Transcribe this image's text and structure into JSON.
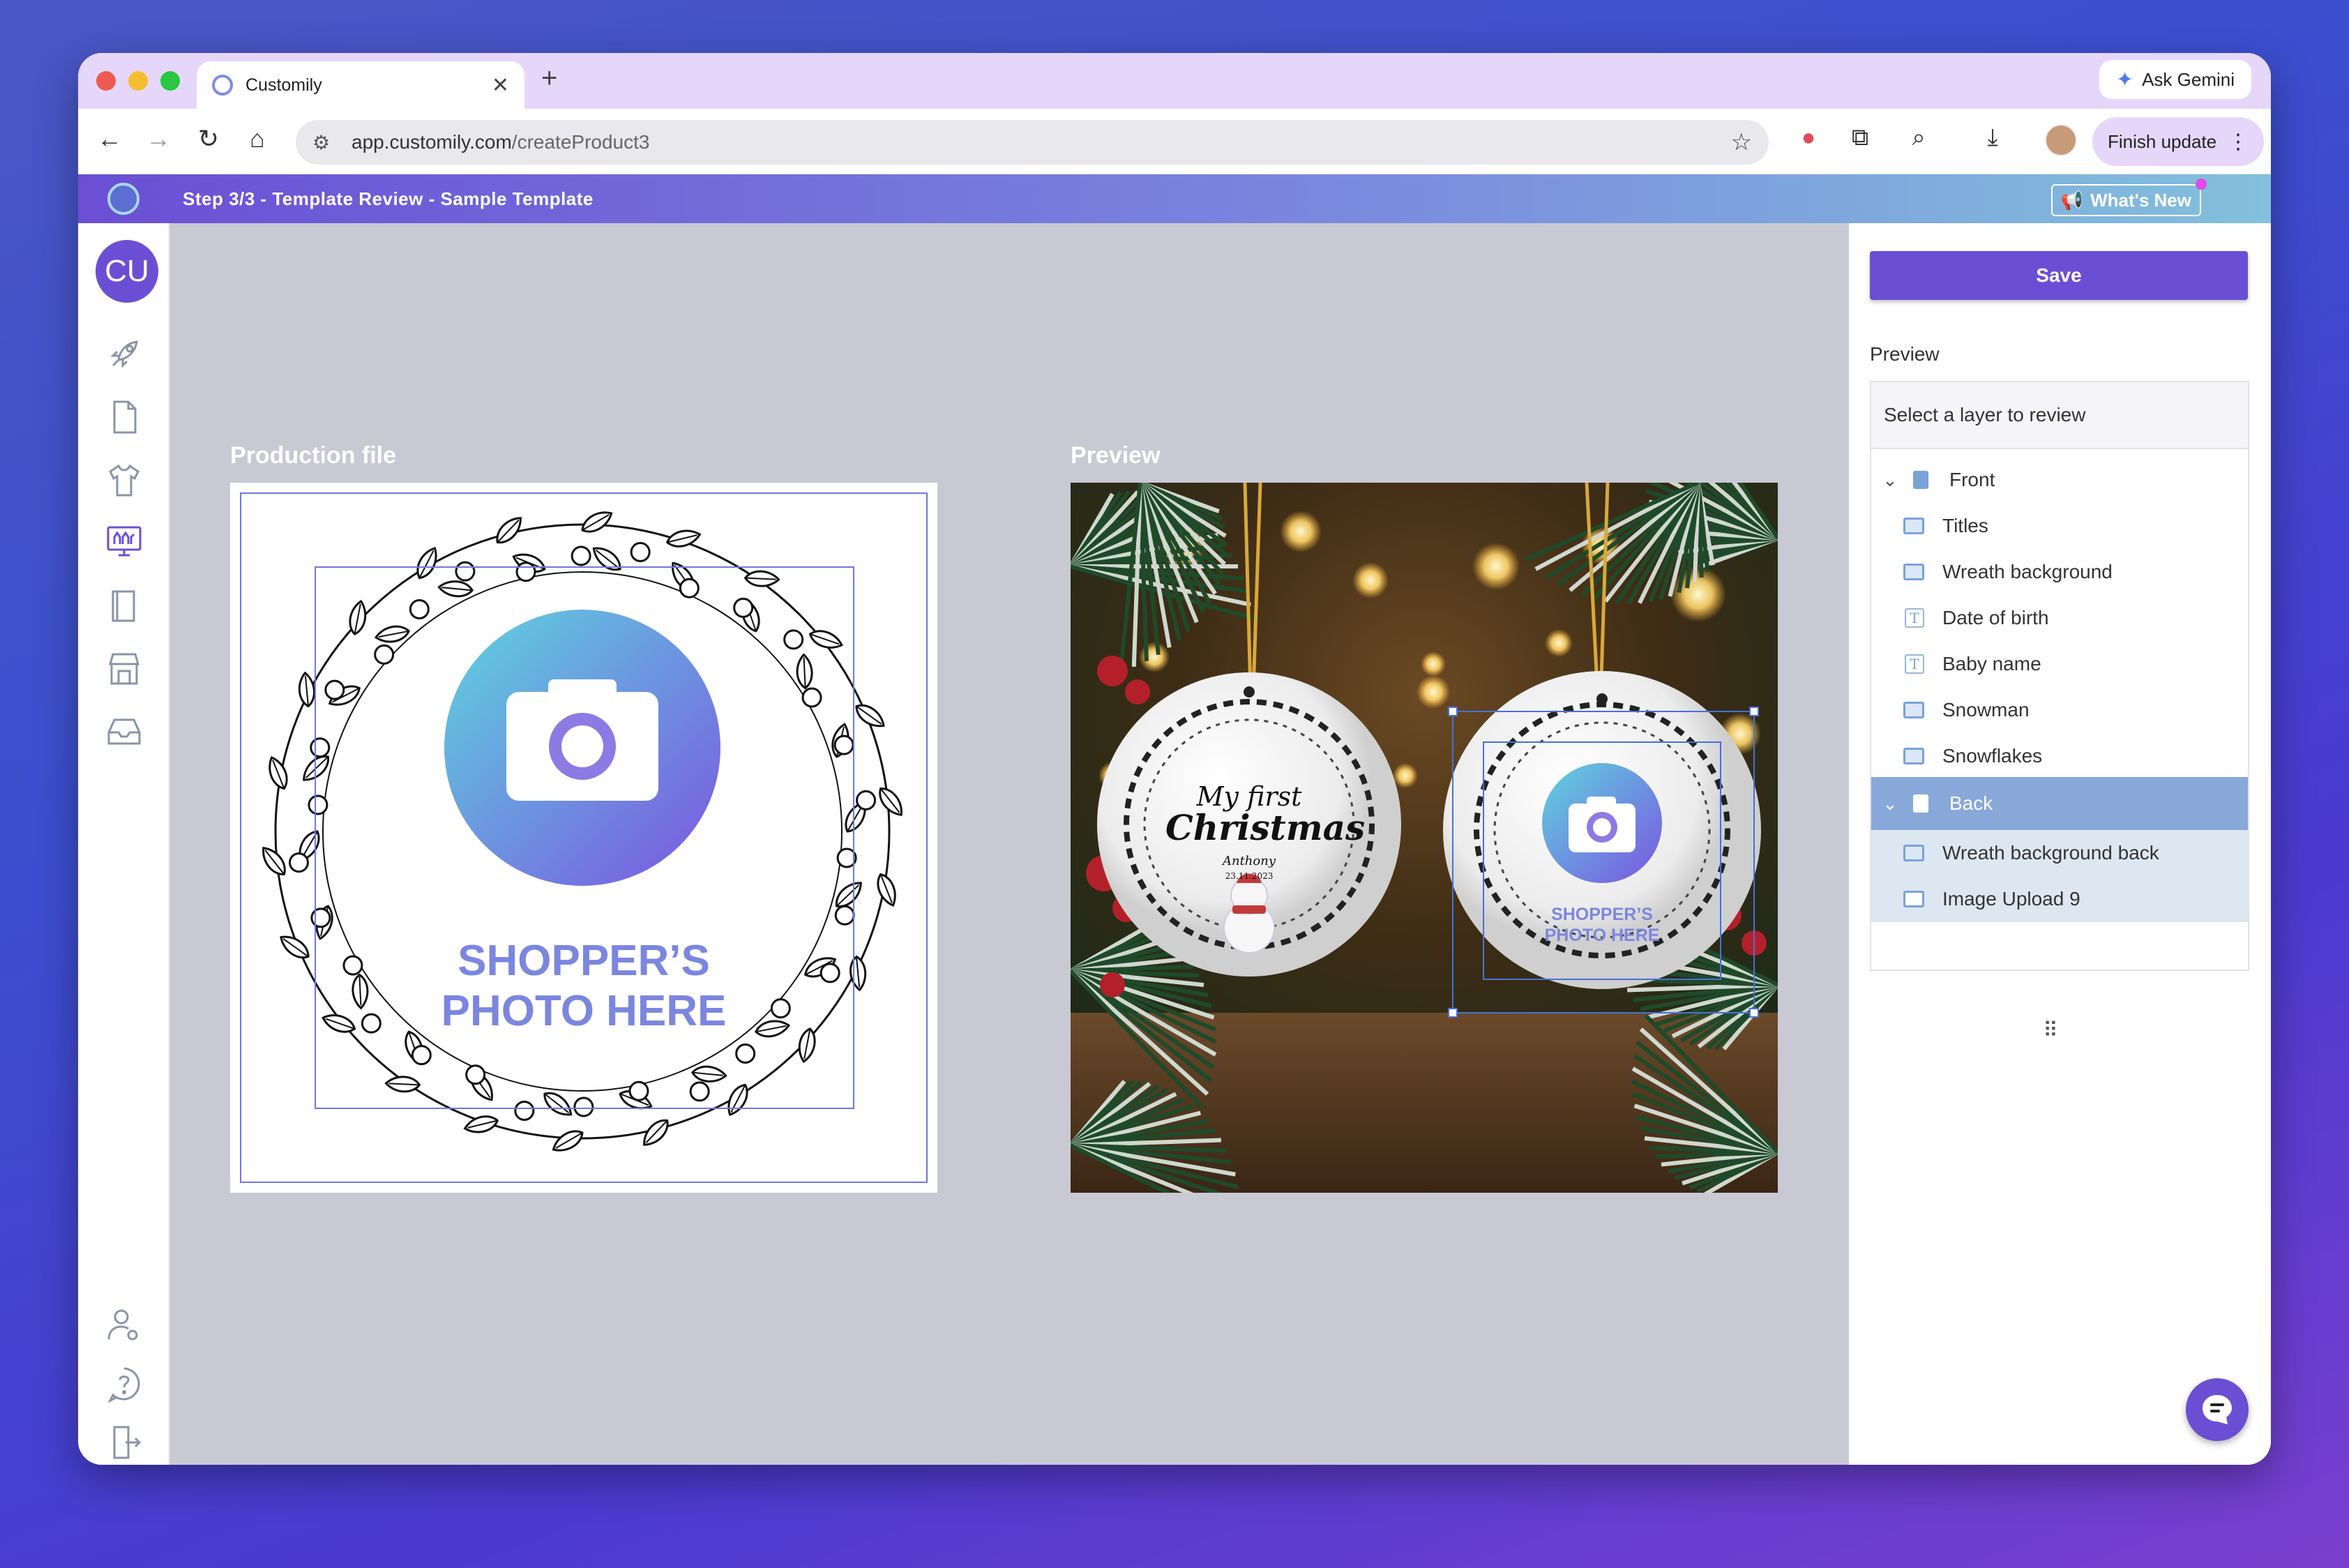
{
  "browser": {
    "tab_title": "Customily",
    "new_tab": "+",
    "ask_gemini": "Ask Gemini",
    "url_domain": "app.customily.com",
    "url_path": "/createProduct3",
    "finish_update": "Finish update"
  },
  "app": {
    "step_title": "Step 3/3 - Template Review - Sample Template",
    "whats_new": "What's New",
    "user_initials": "CU"
  },
  "canvas": {
    "production_label": "Production file",
    "preview_label": "Preview",
    "shopper_line1": "SHOPPER’S",
    "shopper_line2": "PHOTO HERE",
    "ornament_front": {
      "line1": "My first",
      "line2": "Christmas",
      "name": "Anthony",
      "date": "23.11.2023"
    },
    "ornament_back": {
      "line1": "SHOPPER’S",
      "line2": "PHOTO HERE"
    }
  },
  "panel": {
    "save_label": "Save",
    "preview_label": "Preview",
    "select_placeholder": "Select a layer to review",
    "front": {
      "label": "Front",
      "layers": [
        {
          "name": "Titles",
          "kind": "image"
        },
        {
          "name": "Wreath background",
          "kind": "image"
        },
        {
          "name": "Date of birth",
          "kind": "text"
        },
        {
          "name": "Baby name",
          "kind": "text"
        },
        {
          "name": "Snowman",
          "kind": "image"
        },
        {
          "name": "Snowflakes",
          "kind": "image"
        }
      ]
    },
    "back": {
      "label": "Back",
      "layers": [
        {
          "name": "Wreath background back",
          "kind": "image"
        },
        {
          "name": "Image Upload 9",
          "kind": "upload"
        }
      ]
    }
  },
  "colors": {
    "accent": "#6a4fd4",
    "selected_row": "#87a8d8",
    "selected_child": "#dde7f2",
    "canvas_bg": "#c9c9d4"
  }
}
